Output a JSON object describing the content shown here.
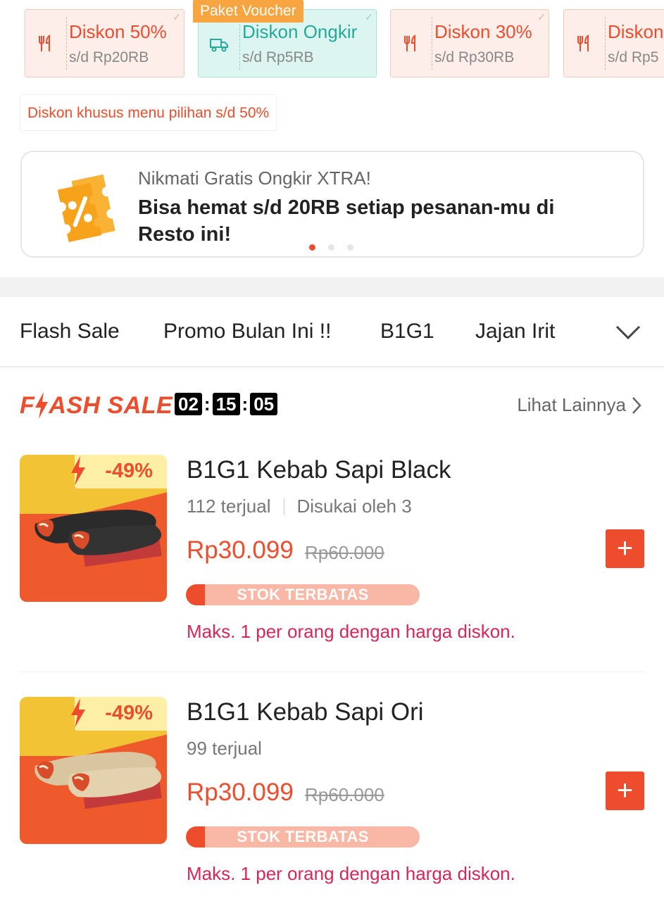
{
  "vouchers": [
    {
      "title": "Diskon 50%",
      "sub": "s/d Rp20RB",
      "icon": "restaurant-icon",
      "style": "red"
    },
    {
      "title": "Diskon Ongkir",
      "sub": "s/d Rp5RB",
      "icon": "delivery-truck-icon",
      "style": "teal"
    },
    {
      "title": "Diskon 30%",
      "sub": "s/d Rp30RB",
      "icon": "restaurant-icon",
      "style": "red"
    },
    {
      "title": "Diskon",
      "sub": "s/d Rp5",
      "icon": "restaurant-icon",
      "style": "red"
    }
  ],
  "paket_label": "Paket Voucher",
  "menu_note": "Diskon khusus menu pilihan s/d 50%",
  "promo": {
    "sub": "Nikmati Gratis Ongkir XTRA!",
    "main": "Bisa hemat s/d 20RB setiap pesanan-mu di Resto ini!",
    "icon": "percent-ticket-icon"
  },
  "tabs": [
    "Flash Sale",
    "Promo Bulan Ini !!",
    "B1G1",
    "Jajan Irit"
  ],
  "flash": {
    "logo_f": "F",
    "logo_rest": "ASH SALE",
    "timer": {
      "h": "02",
      "m": "15",
      "s": "05"
    },
    "colon": ":",
    "more": "Lihat Lainnya"
  },
  "products": [
    {
      "name": "B1G1 Kebab Sapi Black",
      "sold": "112 terjual",
      "liked": "Disukai oleh 3",
      "price": "Rp30.099",
      "old_price": "Rp60.000",
      "discount": "-49%",
      "stock_label": "STOK TERBATAS",
      "stock_fill": 0.08,
      "limit": "Maks. 1 per orang dengan harga diskon.",
      "add": "+"
    },
    {
      "name": "B1G1 Kebab Sapi Ori",
      "sold": "99 terjual",
      "liked": "",
      "price": "Rp30.099",
      "old_price": "Rp60.000",
      "discount": "-49%",
      "stock_label": "STOK TERBATAS",
      "stock_fill": 0.08,
      "limit": "Maks. 1 per orang dengan harga diskon.",
      "add": "+"
    }
  ],
  "colors": {
    "accent": "#ee4d2d",
    "teal": "#26aa99",
    "paket": "#f6a540",
    "limit": "#d9265a"
  }
}
